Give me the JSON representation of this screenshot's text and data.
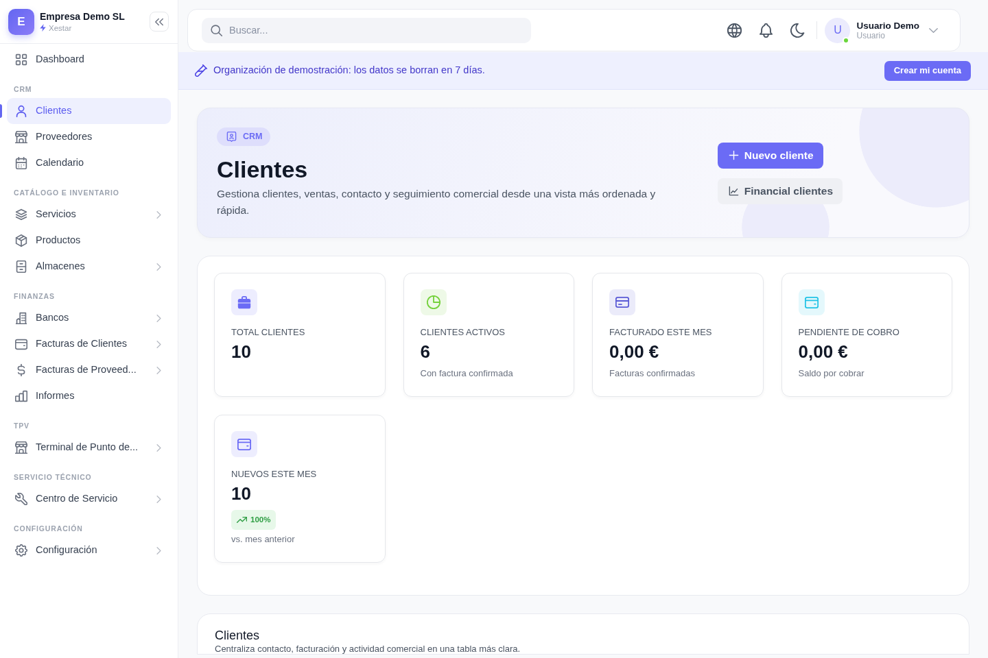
{
  "sidebar": {
    "brand": {
      "initial": "E",
      "name": "Empresa Demo SL",
      "subtitle": "Xestar"
    },
    "sections": [
      {
        "items": [
          {
            "label": "Dashboard",
            "selected": false,
            "has_submenu": false
          }
        ]
      },
      {
        "title": "CRM",
        "items": [
          {
            "label": "Clientes",
            "selected": true,
            "has_submenu": false
          },
          {
            "label": "Proveedores",
            "selected": false,
            "has_submenu": false
          },
          {
            "label": "Calendario",
            "selected": false,
            "has_submenu": false
          }
        ]
      },
      {
        "title": "CATÁLOGO E INVENTARIO",
        "items": [
          {
            "label": "Servicios",
            "selected": false,
            "has_submenu": true
          },
          {
            "label": "Productos",
            "selected": false,
            "has_submenu": false
          },
          {
            "label": "Almacenes",
            "selected": false,
            "has_submenu": true
          }
        ]
      },
      {
        "title": "FINANZAS",
        "items": [
          {
            "label": "Bancos",
            "selected": false,
            "has_submenu": true
          },
          {
            "label": "Facturas de Clientes",
            "selected": false,
            "has_submenu": true
          },
          {
            "label": "Facturas de Proveed...",
            "selected": false,
            "has_submenu": true
          },
          {
            "label": "Informes",
            "selected": false,
            "has_submenu": false
          }
        ]
      },
      {
        "title": "TPV",
        "items": [
          {
            "label": "Terminal de Punto de...",
            "selected": false,
            "has_submenu": true
          }
        ]
      },
      {
        "title": "SERVICIO TÉCNICO",
        "items": [
          {
            "label": "Centro de Servicio",
            "selected": false,
            "has_submenu": true
          }
        ]
      },
      {
        "title": "CONFIGURACIÓN",
        "items": [
          {
            "label": "Configuración",
            "selected": false,
            "has_submenu": true
          }
        ]
      }
    ]
  },
  "topbar": {
    "search": {
      "placeholder": "Buscar..."
    },
    "user": {
      "initial": "U",
      "name": "Usuario Demo",
      "role": "Usuario",
      "online": true
    }
  },
  "demo_banner": {
    "message": "Organización de demostración: los datos se borran en 7 días.",
    "button": "Crear mi cuenta"
  },
  "page_header": {
    "badge": "CRM",
    "title": "Clientes",
    "description": "Gestiona clientes, ventas, contacto y seguimiento comercial desde una vista más ordenada y rápida.",
    "actions": [
      {
        "kind": "primary",
        "label": "Nuevo cliente"
      },
      {
        "kind": "secondary",
        "label": "Financial clientes"
      }
    ]
  },
  "stats": [
    {
      "label": "TOTAL CLIENTES",
      "value": "10",
      "color": "#6b6bf5"
    },
    {
      "label": "CLIENTES ACTIVOS",
      "value": "6",
      "subtext": "Con factura confirmada",
      "color": "#74d13c"
    },
    {
      "label": "FACTURADO ESTE MES",
      "value": "0,00 €",
      "subtext": "Facturas confirmadas",
      "color": "#5b5bd6"
    },
    {
      "label": "PENDIENTE DE COBRO",
      "value": "0,00 €",
      "subtext": "Saldo por cobrar",
      "color": "#22c3e6"
    },
    {
      "label": "NUEVOS ESTE MES",
      "value": "10",
      "trend": "100%",
      "subtext": "vs. mes anterior",
      "color": "#6b6bf5"
    }
  ],
  "table_card": {
    "title": "Clientes",
    "subtitle": "Centraliza contacto, facturación y actividad comercial en una tabla más clara."
  }
}
